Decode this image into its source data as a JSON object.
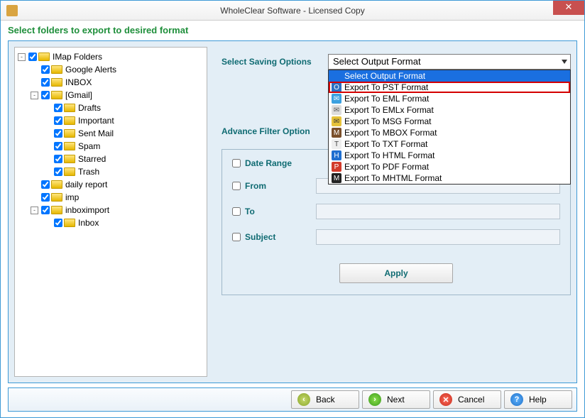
{
  "window": {
    "title": "WholeClear Software - Licensed Copy"
  },
  "subheader": "Select folders to export to desired format",
  "tree": [
    {
      "label": "IMap Folders",
      "exp": "-",
      "children": [
        {
          "label": "Google Alerts"
        },
        {
          "label": "INBOX"
        },
        {
          "label": "[Gmail]",
          "exp": "-",
          "children": [
            {
              "label": "Drafts"
            },
            {
              "label": "Important"
            },
            {
              "label": "Sent Mail"
            },
            {
              "label": "Spam"
            },
            {
              "label": "Starred"
            },
            {
              "label": "Trash"
            }
          ]
        },
        {
          "label": "daily report"
        },
        {
          "label": "imp"
        },
        {
          "label": "inboximport",
          "exp": "-",
          "children": [
            {
              "label": "Inbox"
            }
          ]
        }
      ]
    }
  ],
  "options": {
    "label": "Select Saving Options",
    "selected": "Select Output Format",
    "highlight_index": 1,
    "items": [
      {
        "text": "Select Output Format",
        "icon": "",
        "bg": "",
        "fg": ""
      },
      {
        "text": "Export To PST Format",
        "icon": "O",
        "bg": "#2b6fc2",
        "fg": "#fff"
      },
      {
        "text": "Export To EML Format",
        "icon": "✉",
        "bg": "#3aa0e0",
        "fg": "#fff"
      },
      {
        "text": "Export To EMLx Format",
        "icon": "✉",
        "bg": "#ddd",
        "fg": "#555"
      },
      {
        "text": "Export To MSG Format",
        "icon": "✉",
        "bg": "#e6c23a",
        "fg": "#333"
      },
      {
        "text": "Export To MBOX Format",
        "icon": "M",
        "bg": "#7a4f2a",
        "fg": "#fff"
      },
      {
        "text": "Export To TXT Format",
        "icon": "T",
        "bg": "#eee",
        "fg": "#444"
      },
      {
        "text": "Export To HTML Format",
        "icon": "H",
        "bg": "#1f6fd0",
        "fg": "#fff"
      },
      {
        "text": "Export To PDF Format",
        "icon": "P",
        "bg": "#d23a2a",
        "fg": "#fff"
      },
      {
        "text": "Export To MHTML Format",
        "icon": "M",
        "bg": "#222",
        "fg": "#fff"
      }
    ]
  },
  "advance_label": "Advance Filter Option",
  "filters": {
    "date_range": "Date Range",
    "from": "From",
    "to": "To",
    "subject": "Subject",
    "apply": "Apply"
  },
  "footer": {
    "back": "Back",
    "next": "Next",
    "cancel": "Cancel",
    "help": "Help"
  }
}
